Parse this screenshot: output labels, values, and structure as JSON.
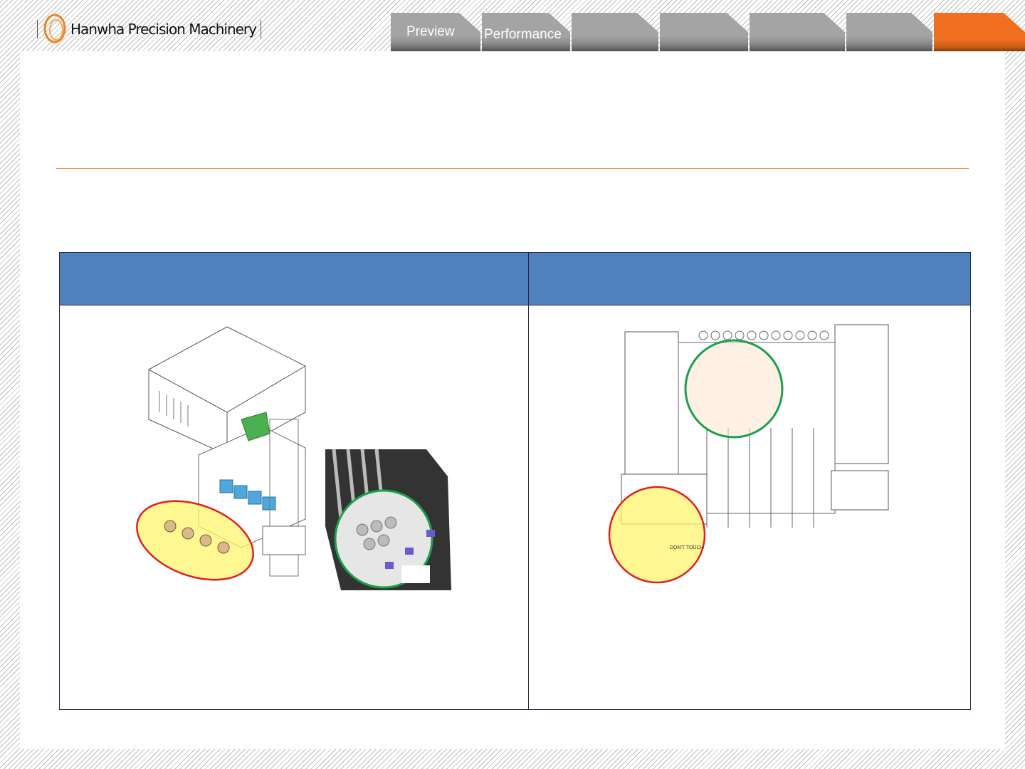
{
  "header": {
    "brand": "Hanwha Precision Machinery"
  },
  "tabs": [
    {
      "label": "Preview",
      "active": false
    },
    {
      "label": "Performance",
      "active": false
    },
    {
      "label": "",
      "active": false
    },
    {
      "label": "",
      "active": false
    },
    {
      "label": "",
      "active": false
    },
    {
      "label": "",
      "active": false
    },
    {
      "label": "",
      "active": true
    }
  ],
  "colors": {
    "accent": "#f07020",
    "table_header": "#4f81bd",
    "tab": "#a4a4a4"
  },
  "table": {
    "headers": [
      "",
      ""
    ],
    "images": [
      {
        "callouts": [
          "yellow-red-circle",
          "green-circle"
        ]
      },
      {
        "callouts": [
          "green-circle",
          "yellow-red-circle"
        ]
      }
    ],
    "sticker_text": "DON'T TOUCH"
  }
}
